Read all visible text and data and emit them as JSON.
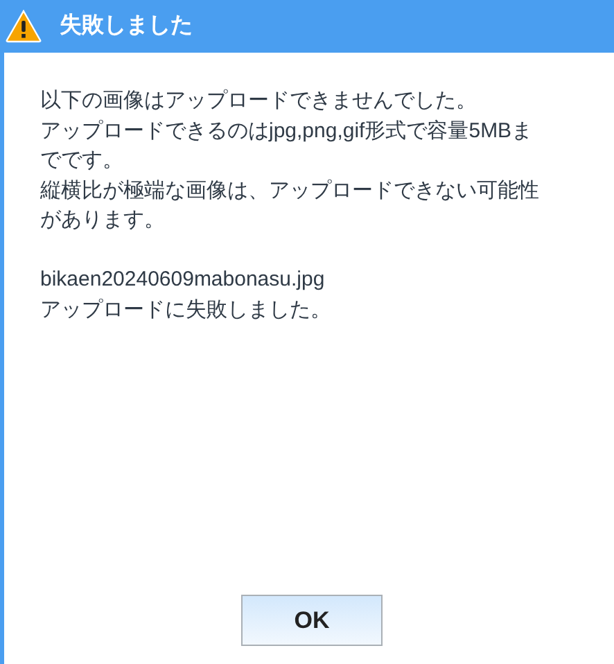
{
  "dialog": {
    "title": "失敗しました",
    "message_lines": [
      "以下の画像はアップロードできませんでした。",
      "アップロードできるのはjpg,png,gif形式で容量5MBま",
      "でです。",
      "縦横比が極端な画像は、アップロードできない可能性",
      "があります。"
    ],
    "file_name": "bikaen20240609mabonasu.jpg",
    "result": "アップロードに失敗しました。",
    "buttons": [
      "OK"
    ]
  }
}
